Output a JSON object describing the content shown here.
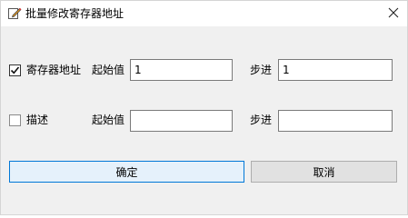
{
  "window": {
    "title": "批量修改寄存器地址",
    "title_icon": "pencil-edit-icon",
    "close_icon": "close-icon"
  },
  "rows": [
    {
      "checkbox_label": "寄存器地址",
      "checked": true,
      "start_label": "起始值",
      "start_value": "1",
      "step_label": "步进",
      "step_value": "1"
    },
    {
      "checkbox_label": "描述",
      "checked": false,
      "start_label": "起始值",
      "start_value": "",
      "step_label": "步进",
      "step_value": ""
    }
  ],
  "buttons": {
    "confirm_label": "确定",
    "cancel_label": "取消"
  },
  "colors": {
    "accent": "#0078d7",
    "dialog_background": "#f0f0f0"
  }
}
